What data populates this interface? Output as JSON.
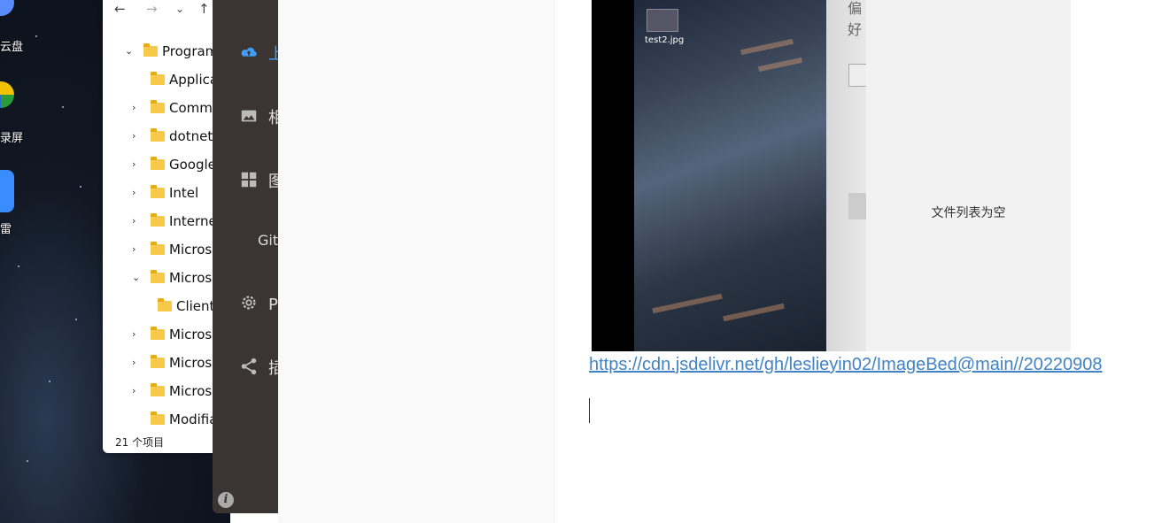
{
  "desktop": {
    "icons": [
      {
        "label": "云盘",
        "icon": "cloud-drive-icon",
        "color": "#5b8cff"
      },
      {
        "label": "录屏",
        "icon": "screen-record-icon",
        "color": "#f2c200"
      },
      {
        "label": "雷",
        "icon": "thunder-icon",
        "color": "#3a8dff"
      }
    ]
  },
  "explorer": {
    "nav": {
      "back": "←",
      "forward": "→",
      "dropdown": "⌄",
      "up": "↑"
    },
    "tree": [
      {
        "name": "Program Files",
        "expanded": true
      },
      {
        "name": "Applications"
      },
      {
        "name": "Common Files"
      },
      {
        "name": "dotnet"
      },
      {
        "name": "Google"
      },
      {
        "name": "Intel"
      },
      {
        "name": "Internet Explorer"
      },
      {
        "name": "Microsoft"
      },
      {
        "name": "Microsoft",
        "expanded": true
      },
      {
        "name": "ClientSetup"
      },
      {
        "name": "Microsoft"
      },
      {
        "name": "Microsoft"
      },
      {
        "name": "Microsoft"
      },
      {
        "name": "Modifiable"
      }
    ],
    "status": "21 个项目"
  },
  "sidebar": {
    "items": [
      {
        "label": "上传区",
        "icon": "upload-cloud-icon",
        "active": true
      },
      {
        "label": "相册",
        "icon": "image-icon"
      },
      {
        "label": "图床设置",
        "icon": "grid-icon"
      },
      {
        "label": "GitHub",
        "icon": ""
      },
      {
        "label": "PicGo设置",
        "icon": "gear-icon"
      },
      {
        "label": "插件设置",
        "icon": "share-icon"
      }
    ],
    "info": "i",
    "accent": "#409eff"
  },
  "embed": {
    "file_label": "test2.jpg",
    "panel_title": "偏好",
    "empty_text": "文件列表为空"
  },
  "editor": {
    "link": "https://cdn.jsdelivr.net/gh/leslieyin02/ImageBed@main//20220908"
  }
}
